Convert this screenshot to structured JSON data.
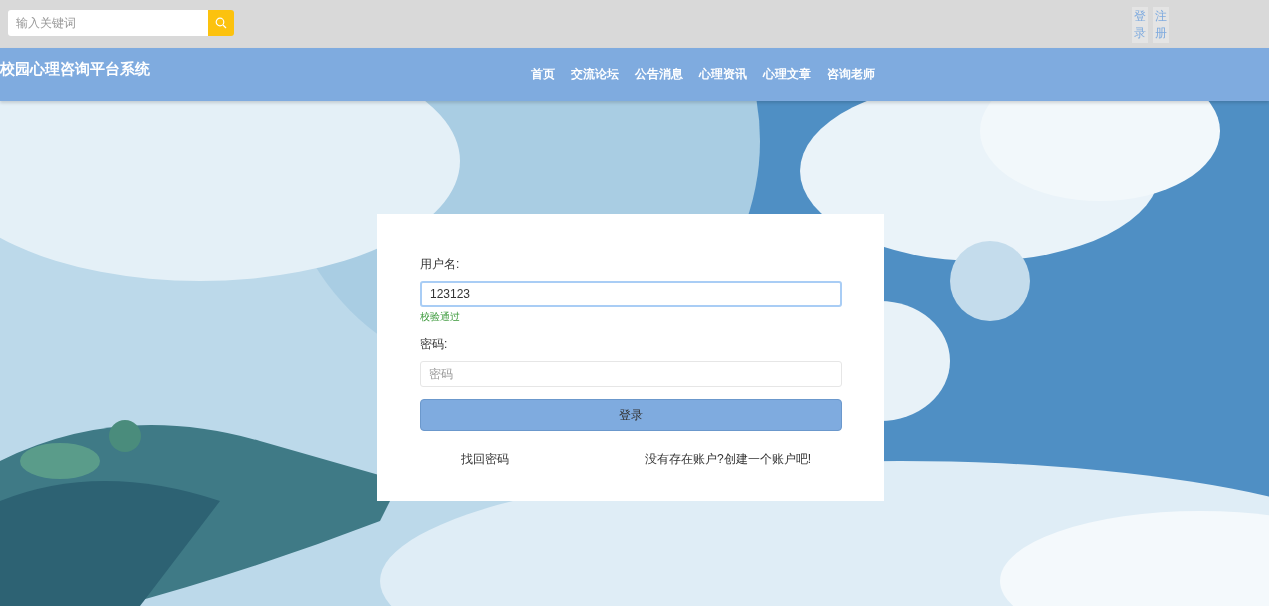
{
  "search": {
    "placeholder": "输入关键词"
  },
  "auth_links": [
    {
      "label": "登录"
    },
    {
      "label": "注册"
    }
  ],
  "header": {
    "title": "校园心理咨询平台系统",
    "nav": [
      {
        "label": "首页"
      },
      {
        "label": "交流论坛"
      },
      {
        "label": "公告消息"
      },
      {
        "label": "心理资讯"
      },
      {
        "label": "心理文章"
      },
      {
        "label": "咨询老师"
      }
    ]
  },
  "login_form": {
    "fields": [
      {
        "label": "用户名:",
        "value": "123123",
        "focused": true,
        "message": "校验通过"
      },
      {
        "label": "密码:",
        "placeholder": "密码",
        "focused": false
      }
    ],
    "submit": "登录",
    "links": [
      "找回密码",
      "没有存在账户?创建一个账户吧!"
    ]
  }
}
